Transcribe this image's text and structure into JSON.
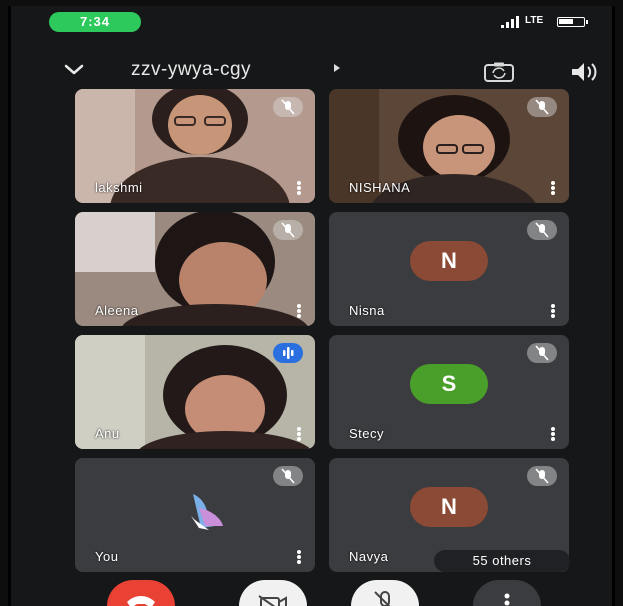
{
  "status_bar": {
    "time": "7:34",
    "network": "LTE"
  },
  "meeting": {
    "code": "zzv-ywya-cgy"
  },
  "participants": [
    {
      "name": "lakshmi",
      "type": "video",
      "mic": "muted"
    },
    {
      "name": "NISHANA",
      "type": "video",
      "mic": "muted"
    },
    {
      "name": "Aleena",
      "type": "video",
      "mic": "muted"
    },
    {
      "name": "Nisna",
      "type": "avatar",
      "initial": "N",
      "avatar_color": "#8a4a35",
      "mic": "muted"
    },
    {
      "name": "Anu",
      "type": "video",
      "mic": "speaking"
    },
    {
      "name": "Stecy",
      "type": "avatar",
      "initial": "S",
      "avatar_color": "#4a9e2a",
      "mic": "muted"
    },
    {
      "name": "You",
      "type": "self",
      "mic": "muted"
    },
    {
      "name": "Navya",
      "type": "avatar",
      "initial": "N",
      "avatar_color": "#8a4a35",
      "mic": "muted"
    }
  ],
  "others": {
    "label": "55 others"
  },
  "colors": {
    "accent_speaking": "#2a6fe0",
    "status_pill": "#2ec95c",
    "end_call": "#e94235"
  },
  "icons": [
    "chevron-down-icon",
    "camera-flip-icon",
    "speaker-icon",
    "mic-off-icon",
    "mic-on-icon",
    "more-vert-icon",
    "end-call-icon",
    "camera-off-icon",
    "mic-off-icon",
    "more-options-icon"
  ]
}
